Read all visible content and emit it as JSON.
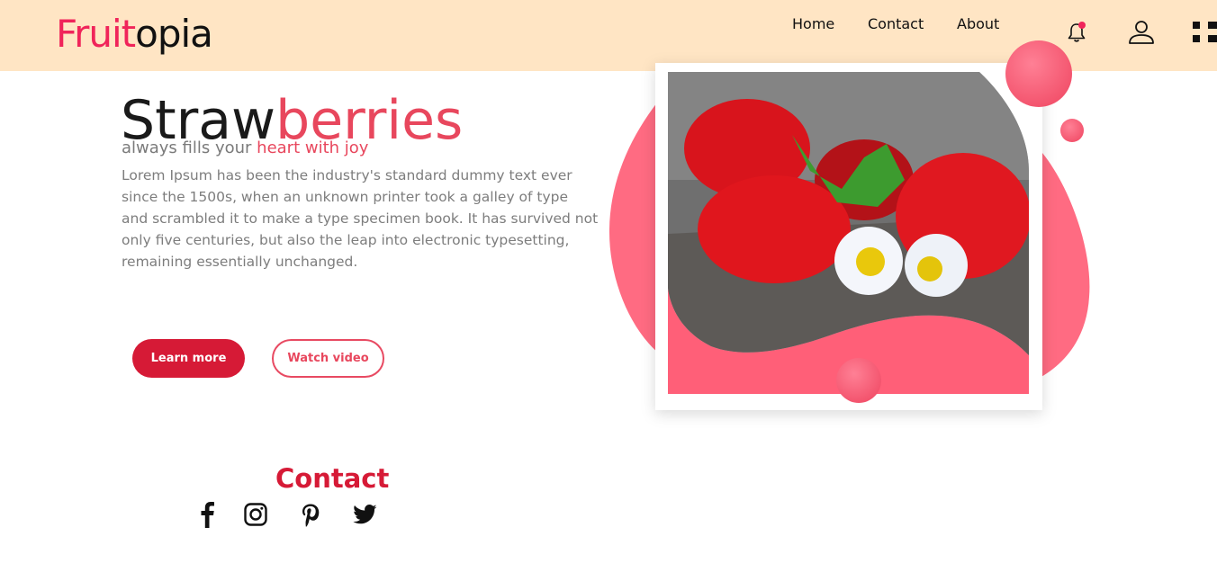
{
  "brand": {
    "logo_part1": "Fruit",
    "logo_part2": "opia"
  },
  "nav": {
    "links": [
      "Home",
      "Contact",
      "About"
    ]
  },
  "hero": {
    "title_dark": "Straw",
    "title_pink": "berries",
    "subtitle_prefix": "always fills your ",
    "subtitle_highlight": "heart with joy",
    "description": "Lorem Ipsum has been the industry's standard dummy text ever since the 1500s, when an unknown printer took a galley of type and scrambled it to make a type specimen book. It has survived not only five centuries, but also the leap into electronic typesetting, remaining essentially unchanged.",
    "primary_button": "Learn more",
    "secondary_button": "Watch video"
  },
  "contact": {
    "title": "Contact",
    "social_icons": [
      "facebook-icon",
      "instagram-icon",
      "pinterest-icon",
      "twitter-icon"
    ]
  },
  "colors": {
    "navbar_bg": "#ffe5c4",
    "brand_pink": "#f0245a",
    "accent_red": "#d61a36",
    "blob_pink": "#ff6b82"
  }
}
